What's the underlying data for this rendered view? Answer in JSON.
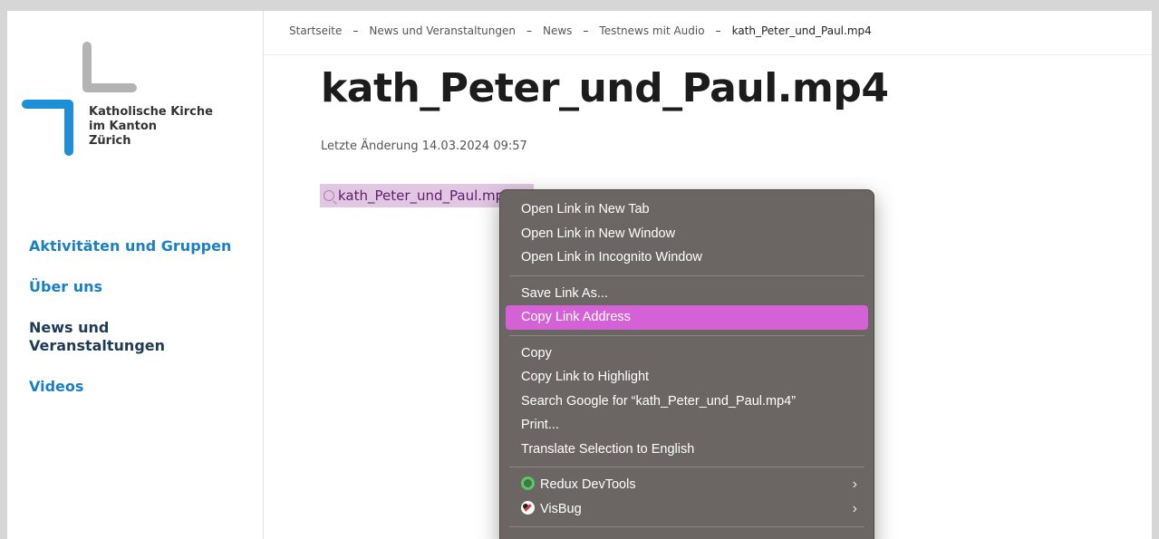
{
  "logo": {
    "line1": "Katholische Kirche",
    "line2": "im Kanton",
    "line3": "Zürich"
  },
  "sidebar": {
    "items": [
      {
        "label": "Aktivitäten und Gruppen"
      },
      {
        "label": "Über uns"
      },
      {
        "label": "News und Veranstaltungen"
      },
      {
        "label": "Videos"
      }
    ]
  },
  "breadcrumb": {
    "items": [
      "Startseite",
      "News und Veranstaltungen",
      "News",
      "Testnews mit Audio",
      "kath_Peter_und_Paul.mp4"
    ],
    "separator": "–"
  },
  "page": {
    "title": "kath_Peter_und_Paul.mp4",
    "last_change": "Letzte Änderung 14.03.2024 09:57",
    "file_link": "kath_Peter_und_Paul.mp4"
  },
  "context_menu": {
    "group1": [
      "Open Link in New Tab",
      "Open Link in New Window",
      "Open Link in Incognito Window"
    ],
    "group2": [
      "Save Link As...",
      "Copy Link Address"
    ],
    "group3": [
      "Copy",
      "Copy Link to Highlight",
      "Search Google for “kath_Peter_und_Paul.mp4”",
      "Print...",
      "Translate Selection to English"
    ],
    "group4": [
      {
        "label": "Redux DevTools",
        "icon": "redux-devtools-icon"
      },
      {
        "label": "VisBug",
        "icon": "visbug-icon"
      }
    ],
    "submenu_arrow": "›"
  },
  "colors": {
    "brand_blue": "#1c8fd6",
    "brand_gray": "#b3b3b3",
    "nav_link": "#1a7fc4",
    "nav_active": "#1f3a55",
    "link_highlight_bg": "#e2c7e2",
    "menu_bg": "#6b6663",
    "menu_highlight": "#d462d6"
  }
}
